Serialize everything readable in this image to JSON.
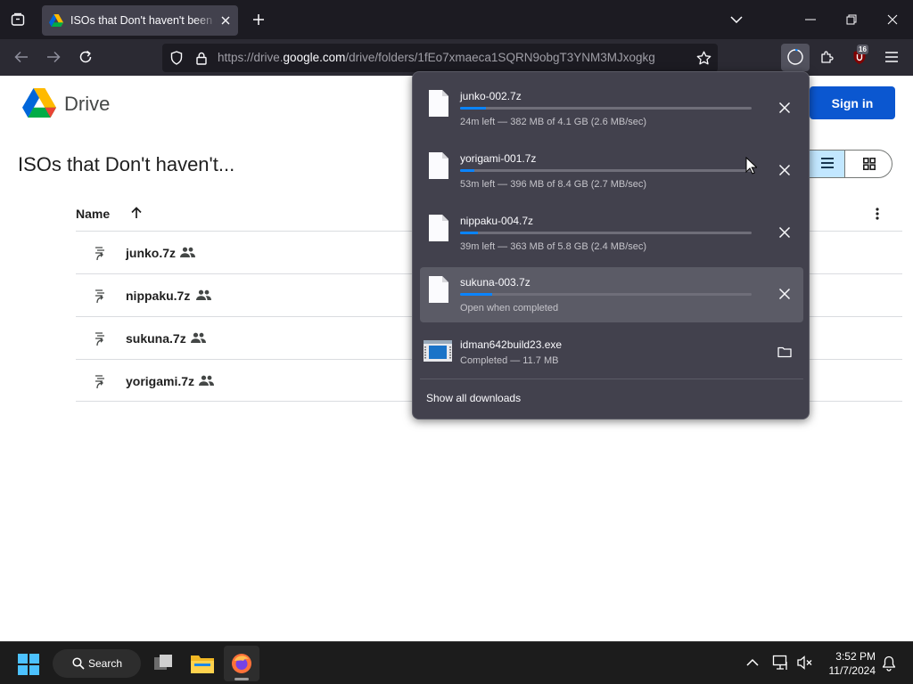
{
  "browser": {
    "tab_title": "ISOs that Don't haven't been uploaded",
    "url_prefix": "https://drive.",
    "url_domain": "google.com",
    "url_path": "/drive/folders/1fEo7xmaeca1SQRN9obgT3YNM3MJxogkg",
    "extension_badge": "16"
  },
  "drive": {
    "product_name": "Drive",
    "folder_title": "ISOs that Don't haven't...",
    "sign_in_label": "Sign in",
    "column_name": "Name",
    "files": [
      {
        "name": "junko.7z"
      },
      {
        "name": "nippaku.7z"
      },
      {
        "name": "sukuna.7z"
      },
      {
        "name": "yorigami.7z"
      }
    ]
  },
  "downloads": {
    "items": [
      {
        "name": "junko-002.7z",
        "status": "24m left — 382 MB of 4.1 GB (2.6 MB/sec)",
        "progress": 0.09,
        "highlighted": false
      },
      {
        "name": "yorigami-001.7z",
        "status": "53m left — 396 MB of 8.4 GB (2.7 MB/sec)",
        "progress": 0.05,
        "highlighted": false
      },
      {
        "name": "nippaku-004.7z",
        "status": "39m left — 363 MB of 5.8 GB (2.4 MB/sec)",
        "progress": 0.06,
        "highlighted": false
      },
      {
        "name": "sukuna-003.7z",
        "status": "Open when completed",
        "progress": 0.11,
        "highlighted": true
      },
      {
        "name": "idman642build23.exe",
        "status": "Completed — 11.7 MB",
        "progress": 1,
        "highlighted": false
      }
    ],
    "show_all_label": "Show all downloads",
    "accent_color": "#0a84ff"
  },
  "taskbar": {
    "search_label": "Search",
    "time": "3:52 PM",
    "date": "11/7/2024"
  }
}
